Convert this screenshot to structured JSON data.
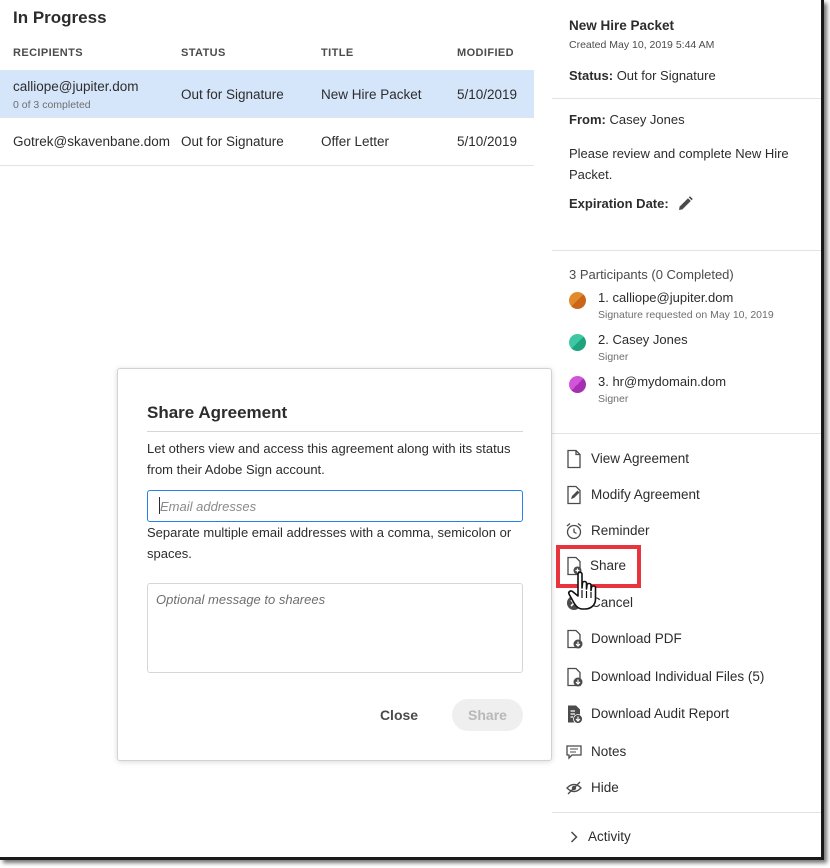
{
  "list": {
    "section_title": "In Progress",
    "columns": [
      "RECIPIENTS",
      "STATUS",
      "TITLE",
      "MODIFIED"
    ],
    "rows": [
      {
        "recipient": "calliope@jupiter.dom",
        "sub": "0 of 3 completed",
        "status": "Out for Signature",
        "title": "New Hire Packet",
        "modified": "5/10/2019",
        "selected": true
      },
      {
        "recipient": "Gotrek@skavenbane.dom",
        "sub": "",
        "status": "Out for Signature",
        "title": "Offer Letter",
        "modified": "5/10/2019",
        "selected": false
      }
    ]
  },
  "details": {
    "title": "New Hire Packet",
    "created": "Created May 10, 2019 5:44 AM",
    "status_label": "Status:",
    "status_value": "Out for Signature",
    "from_label": "From:",
    "from_value": "Casey Jones",
    "message": "Please review and complete New Hire Packet.",
    "expiration_label": "Expiration Date:",
    "participants_heading": "3 Participants (0 Completed)",
    "participants": [
      {
        "name": "1. calliope@jupiter.dom",
        "sub": "Signature requested on May 10, 2019",
        "color": "#e08a2c",
        "color2": "#c9661a"
      },
      {
        "name": "2. Casey Jones",
        "sub": "Signer",
        "color": "#3fc7a3",
        "color2": "#1fa37f"
      },
      {
        "name": "3. hr@mydomain.dom",
        "sub": "Signer",
        "color": "#d154d9",
        "color2": "#a52fb0"
      }
    ],
    "actions": [
      {
        "label": "View Agreement",
        "icon": "document-icon"
      },
      {
        "label": "Modify Agreement",
        "icon": "document-edit-icon"
      },
      {
        "label": "Reminder",
        "icon": "alarm-clock-icon"
      },
      {
        "label": "Share",
        "icon": "document-share-icon"
      },
      {
        "label": "Cancel",
        "icon": "cancel-circle-icon"
      },
      {
        "label": "Download PDF",
        "icon": "document-download-icon"
      },
      {
        "label": "Download Individual Files (5)",
        "icon": "document-download-icon"
      },
      {
        "label": "Download Audit Report",
        "icon": "report-download-icon"
      },
      {
        "label": "Notes",
        "icon": "speech-bubble-icon"
      },
      {
        "label": "Hide",
        "icon": "eye-hidden-icon"
      }
    ],
    "activity_label": "Activity",
    "highlight_color": "#e8343c"
  },
  "dialog": {
    "title": "Share Agreement",
    "description": "Let others view and access this agreement along with its status from their Adobe Sign account.",
    "email_placeholder": "Email addresses",
    "email_value": "",
    "email_help": "Separate multiple email addresses with a comma, semicolon or spaces.",
    "message_placeholder": "Optional message to sharees",
    "close_label": "Close",
    "share_label": "Share"
  },
  "colors": {
    "selected_row": "#d6e6fa",
    "input_focus_border": "#2680eb"
  }
}
